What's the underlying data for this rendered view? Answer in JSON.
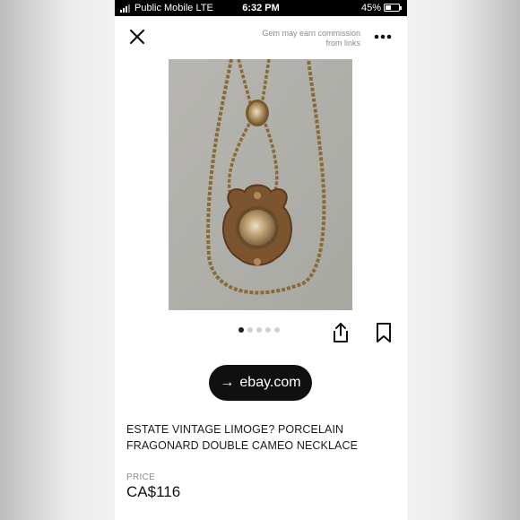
{
  "status_bar": {
    "carrier": "Public Mobile  LTE",
    "time": "6:32 PM",
    "battery_percent": "45%",
    "battery_level": 0.45
  },
  "header": {
    "disclaimer": "Gem may earn commission from links",
    "close_icon": "close-icon",
    "more_icon": "more-horizontal-icon"
  },
  "gallery": {
    "image_count": 5,
    "active_index": 0
  },
  "actions": {
    "share_icon": "share-icon",
    "bookmark_icon": "bookmark-icon"
  },
  "cta": {
    "label": "ebay.com",
    "arrow": "→"
  },
  "listing": {
    "title": "ESTATE VINTAGE LIMOGE? PORCELAIN FRAGONARD DOUBLE CAMEO NECKLACE",
    "price_label": "PRICE",
    "price": "CA$116"
  }
}
